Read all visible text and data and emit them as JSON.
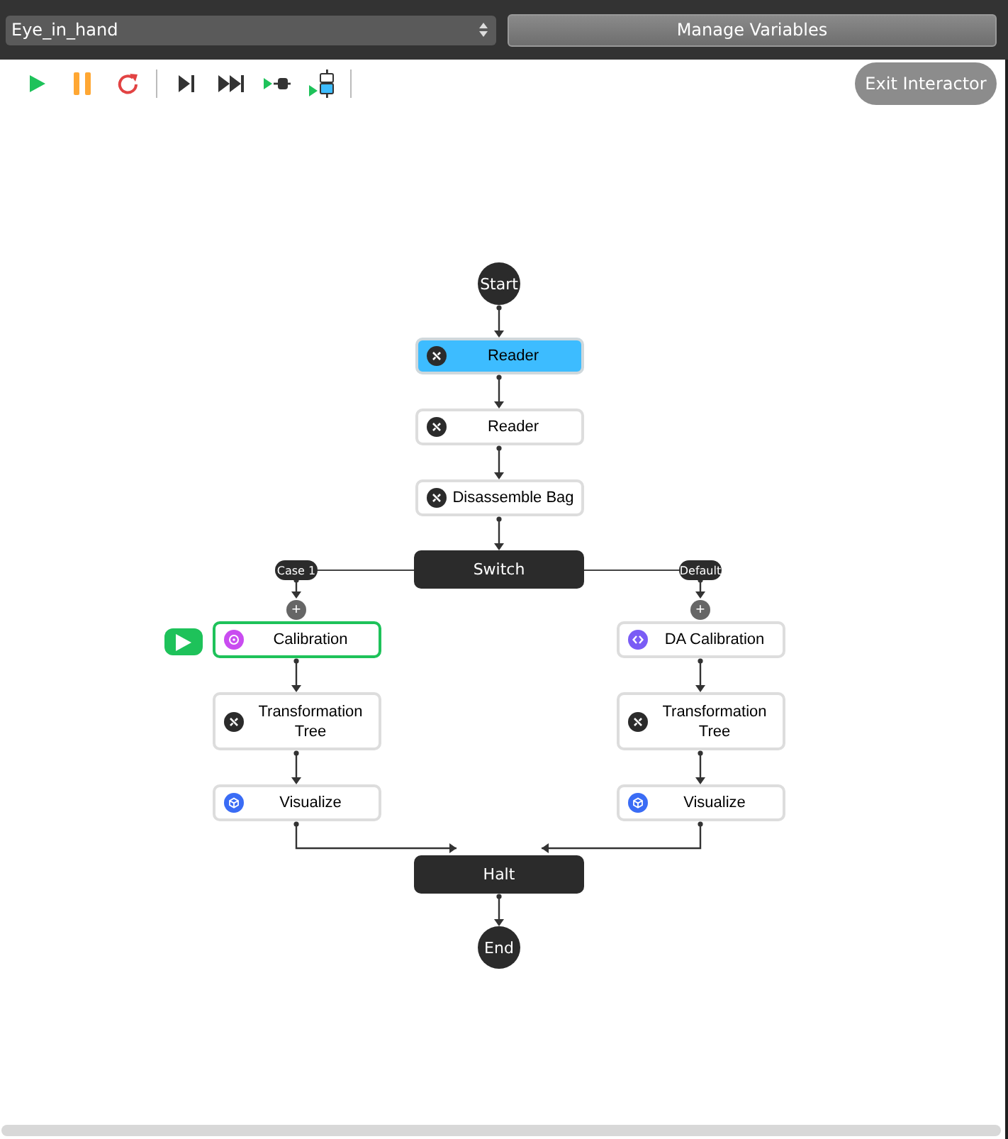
{
  "topbar": {
    "workflow_select": {
      "value": "Eye_in_hand"
    },
    "manage_button": "Manage Variables"
  },
  "toolbar": {
    "groups": [
      [
        {
          "kind": "run"
        },
        {
          "kind": "pause"
        },
        {
          "kind": "restart"
        }
      ],
      [
        {
          "kind": "step"
        },
        {
          "kind": "fast_forward"
        },
        {
          "kind": "run_to_break"
        },
        {
          "kind": "step_into"
        }
      ]
    ],
    "exit_button": "Exit Interactor"
  },
  "flow": {
    "start": "Start",
    "steps": [
      {
        "label": "Reader",
        "kind": "tool",
        "selected": true,
        "running": false
      },
      {
        "label": "Reader",
        "kind": "tool",
        "selected": false,
        "running": false
      },
      {
        "label": "Disassemble Bag",
        "kind": "tool",
        "selected": false,
        "running": false
      }
    ],
    "switch": "Switch",
    "branches": [
      {
        "case": "Case 1",
        "add": "+",
        "steps": [
          {
            "label": "Calibration",
            "kind": "calibration",
            "selected": false,
            "running": true
          },
          {
            "label": "Transformation Tree",
            "kind": "tool",
            "selected": false,
            "running": false
          },
          {
            "label": "Visualize",
            "kind": "visualize",
            "selected": false,
            "running": false
          }
        ]
      },
      {
        "case": "Default",
        "add": "+",
        "steps": [
          {
            "label": "DA Calibration",
            "kind": "code",
            "selected": false,
            "running": false
          },
          {
            "label": "Transformation Tree",
            "kind": "tool",
            "selected": false,
            "running": false
          },
          {
            "label": "Visualize",
            "kind": "visualize",
            "selected": false,
            "running": false
          }
        ]
      }
    ],
    "halt": "Halt",
    "end": "End"
  }
}
